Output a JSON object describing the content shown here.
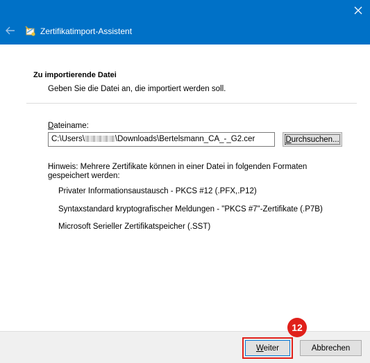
{
  "titlebar": {
    "title": "Zertifikatimport-Assistent",
    "close_icon": "close-icon",
    "back_icon": "back-arrow-icon",
    "app_icon": "certificate-icon",
    "color": "#0071c7"
  },
  "section": {
    "title": "Zu importierende Datei",
    "description": "Geben Sie die Datei an, die importiert werden soll."
  },
  "file": {
    "label_prefix": "D",
    "label_rest": "ateiname:",
    "path_before": "C:\\Users\\",
    "path_after": "\\Downloads\\Bertelsmann_CA_-_G2.cer",
    "browse_prefix": "D",
    "browse_rest": "urchsuchen..."
  },
  "hint": {
    "text": "Hinweis: Mehrere Zertifikate können in einer Datei in folgenden Formaten gespeichert werden:",
    "formats": [
      "Privater Informationsaustausch - PKCS #12 (.PFX,.P12)",
      "Syntaxstandard kryptografischer Meldungen - \"PKCS #7\"-Zertifikate (.P7B)",
      "Microsoft Serieller Zertifikatspeicher (.SST)"
    ]
  },
  "footer": {
    "next_prefix": "W",
    "next_rest": "eiter",
    "cancel_label": "Abbrechen"
  },
  "annotation": {
    "badge": "12",
    "color": "#e0201a"
  }
}
